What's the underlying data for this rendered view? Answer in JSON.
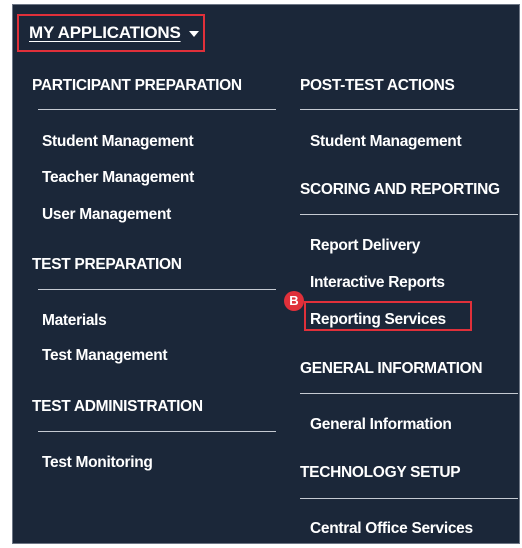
{
  "menu": {
    "title": "MY APPLICATIONS",
    "columns": [
      {
        "sections": [
          {
            "heading": "PARTICIPANT PREPARATION",
            "items": [
              "Student Management",
              "Teacher Management",
              "User Management"
            ]
          },
          {
            "heading": "TEST PREPARATION",
            "items": [
              "Materials",
              "Test Management"
            ]
          },
          {
            "heading": "TEST ADMINISTRATION",
            "items": [
              "Test Monitoring"
            ]
          }
        ]
      },
      {
        "sections": [
          {
            "heading": "POST-TEST ACTIONS",
            "items": [
              "Student Management"
            ]
          },
          {
            "heading": "SCORING AND REPORTING",
            "items": [
              "Report Delivery",
              "Interactive Reports",
              "Reporting Services"
            ]
          },
          {
            "heading": "GENERAL INFORMATION",
            "items": [
              "General Information"
            ]
          },
          {
            "heading": "TECHNOLOGY SETUP",
            "items": [
              "Central Office Services"
            ]
          }
        ]
      }
    ]
  },
  "callout": {
    "label": "B",
    "highlighted_item": "Reporting Services"
  },
  "colors": {
    "panel_bg": "#1b2739",
    "highlight": "#e0303a",
    "text": "#ffffff"
  }
}
